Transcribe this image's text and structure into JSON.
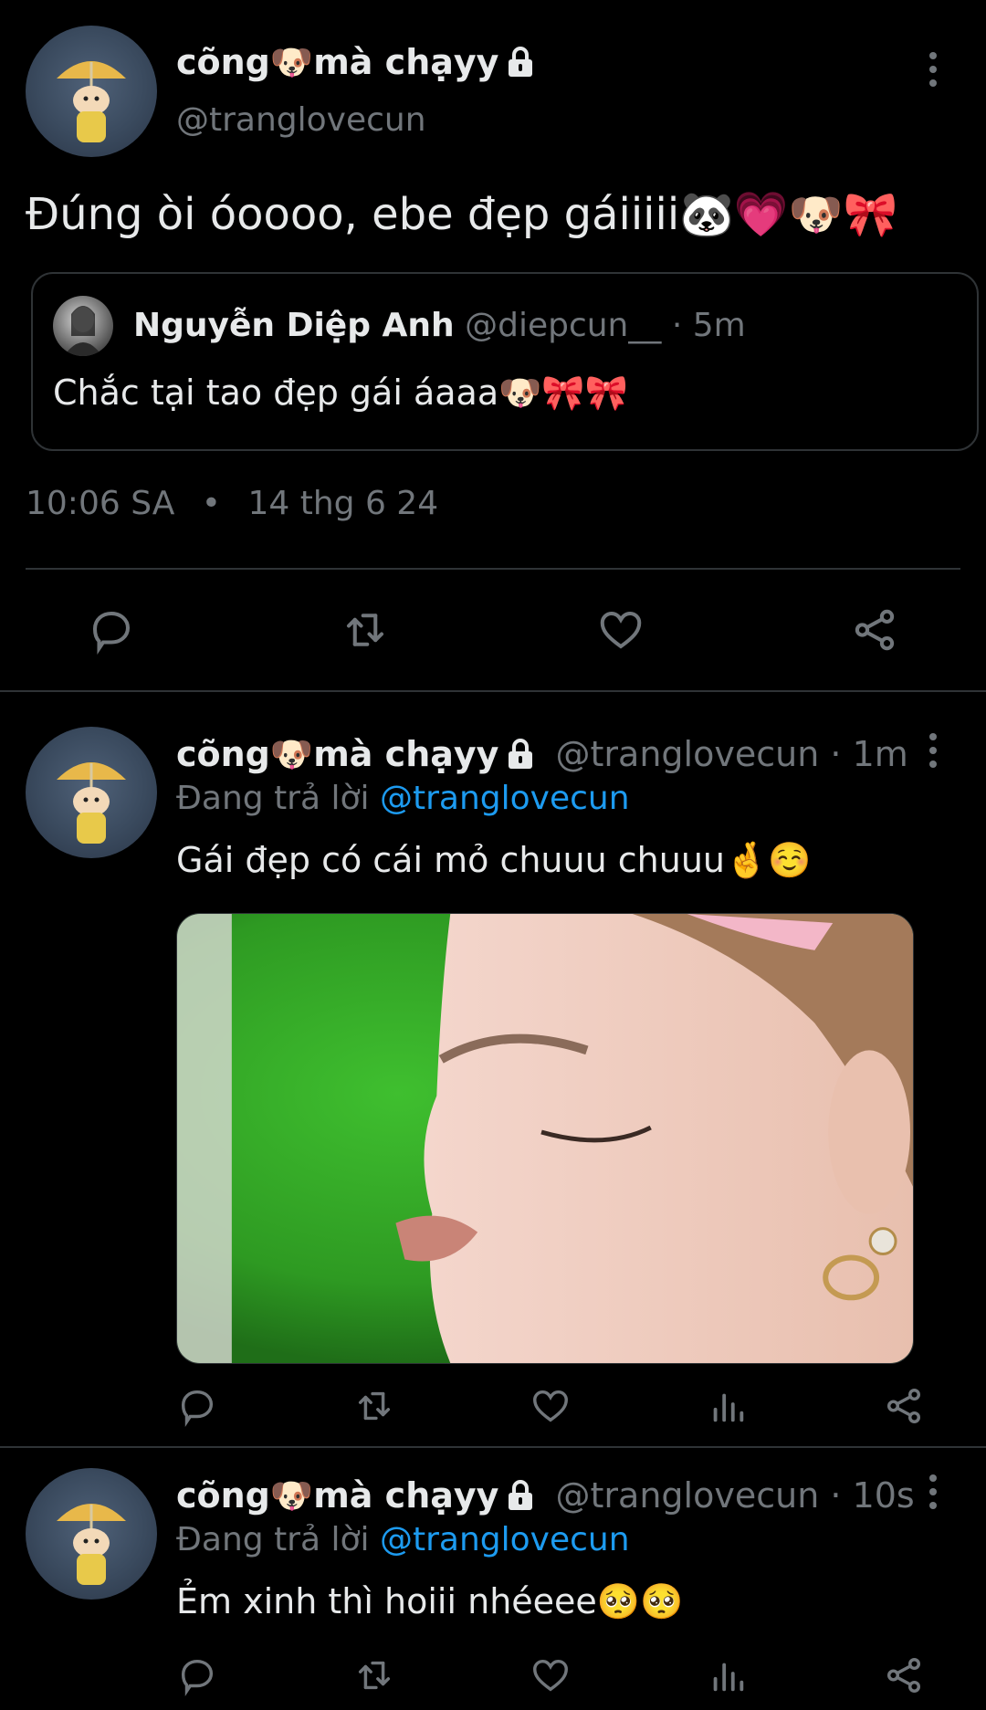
{
  "main_tweet": {
    "display_name": "cõng🐶mà chạyy",
    "handle": "@tranglovecun",
    "text": "Đúng òi óoooo, ebe đẹp gáiiiii🐼💗🐶🎀",
    "quote": {
      "display_name": "Nguyễn Diệp Anh",
      "handle": "@diepcun__",
      "separator": "·",
      "time": "5m",
      "text": "Chắc tại tao đẹp gái áaaa🐶🎀🎀"
    },
    "time": "10:06 SA",
    "dot": "•",
    "date": "14 thg 6 24",
    "actions": [
      "reply-icon",
      "retweet-icon",
      "like-icon",
      "share-icon"
    ]
  },
  "replies": [
    {
      "display_name": "cõng🐶mà chạyy",
      "handle": "@tranglovecun",
      "separator": "·",
      "time": "1m",
      "replying_label": "Đang trả lời",
      "replying_to": "@tranglovecun",
      "text": "Gái đẹp có cái mỏ chuuu chuuu🤞☺️",
      "has_media": true,
      "actions": [
        "reply-icon",
        "retweet-icon",
        "like-icon",
        "views-icon",
        "share-icon"
      ]
    },
    {
      "display_name": "cõng🐶mà chạyy",
      "handle": "@tranglovecun",
      "separator": "·",
      "time": "10s",
      "replying_label": "Đang trả lời",
      "replying_to": "@tranglovecun",
      "text": "Ẻm xinh thì hoiii nhéeee🥺🥺",
      "has_media": false,
      "actions": [
        "reply-icon",
        "retweet-icon",
        "like-icon",
        "views-icon",
        "share-icon"
      ]
    }
  ],
  "colors": {
    "background": "#000000",
    "text": "#e7e9ea",
    "muted": "#71767b",
    "link": "#1d9bf0",
    "border": "#2f3336"
  }
}
